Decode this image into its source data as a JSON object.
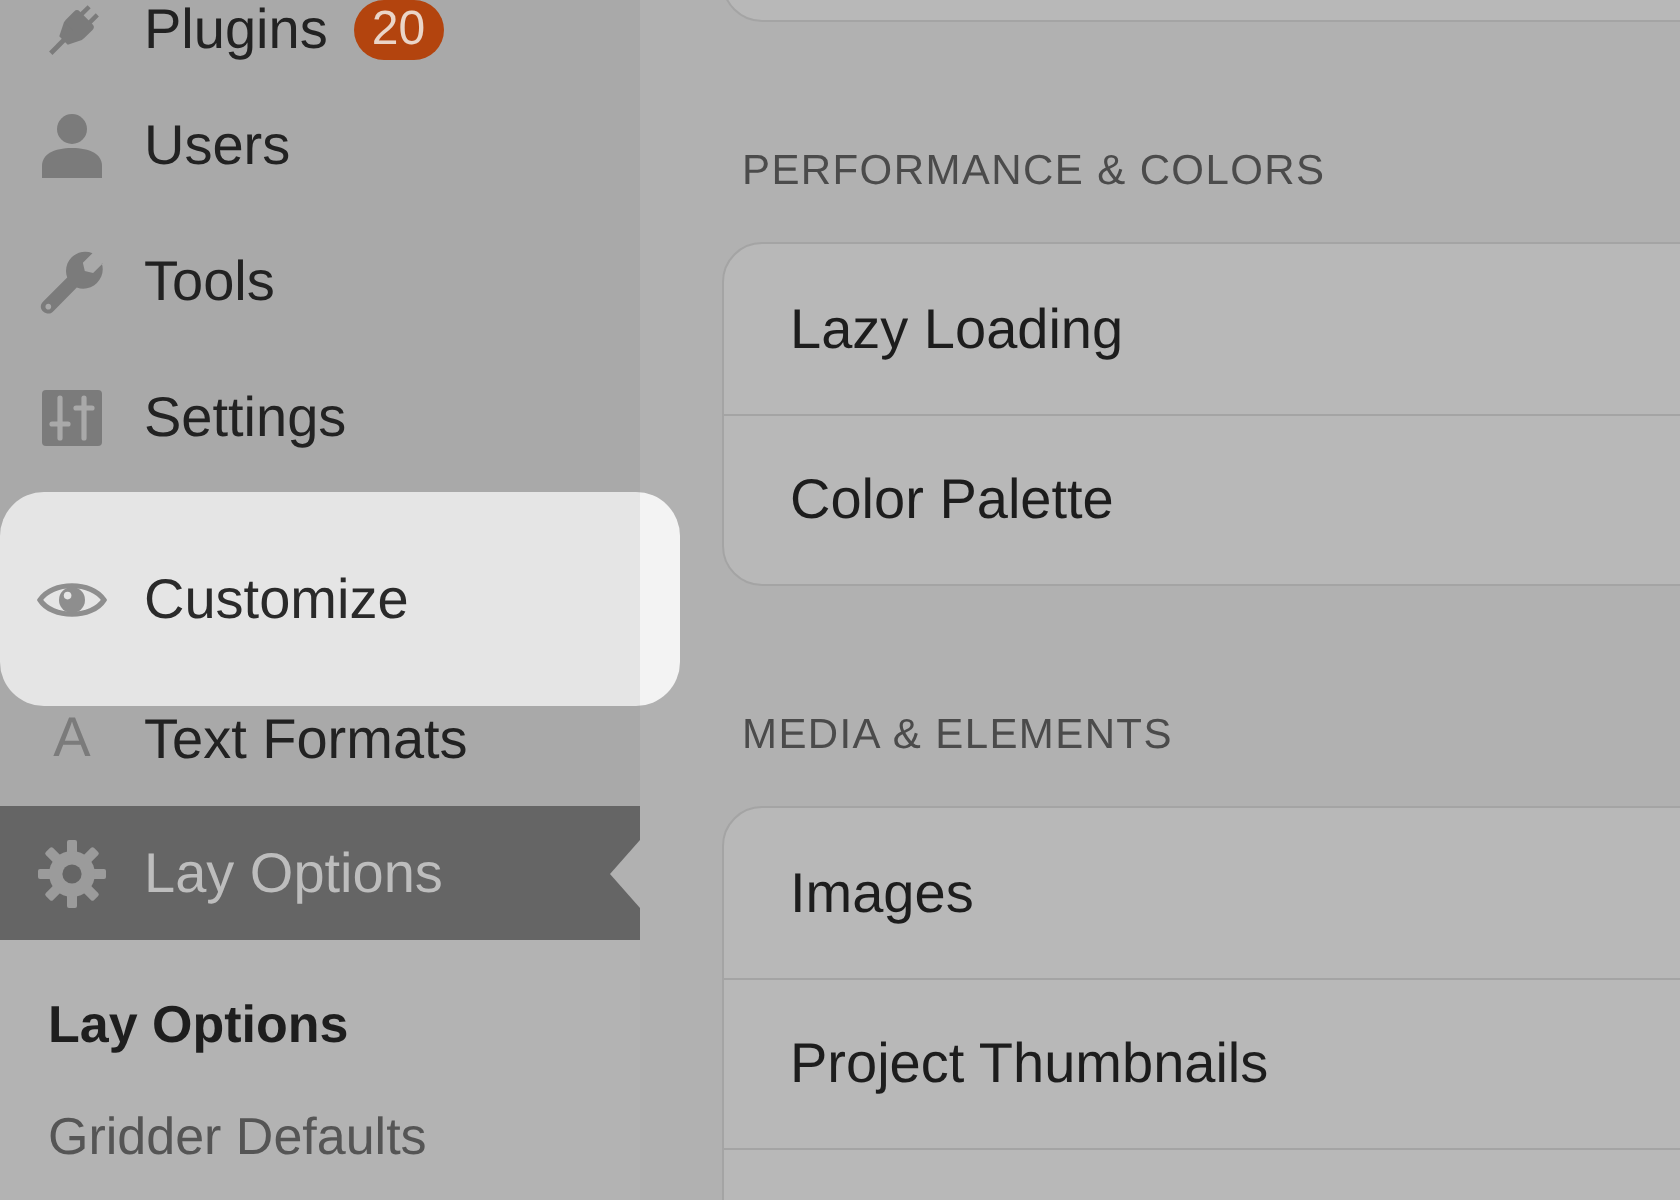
{
  "sidebar": {
    "menu": [
      {
        "label": "Plugins",
        "badge": "20",
        "highlighted": false,
        "current": false
      },
      {
        "label": "Users",
        "highlighted": false,
        "current": false
      },
      {
        "label": "Tools",
        "highlighted": false,
        "current": false
      },
      {
        "label": "Settings",
        "highlighted": false,
        "current": false
      },
      {
        "label": "Customize",
        "highlighted": true,
        "current": false
      },
      {
        "label": "Text Formats",
        "glyph": "A",
        "highlighted": false,
        "current": false
      },
      {
        "label": "Lay Options",
        "highlighted": false,
        "current": true,
        "children": [
          {
            "label": "Lay Options",
            "selected": true
          },
          {
            "label": "Gridder Defaults",
            "selected": false
          }
        ]
      }
    ]
  },
  "main": {
    "sections": [
      {
        "heading": "PERFORMANCE & COLORS",
        "rows": [
          {
            "label": "Lazy Loading"
          },
          {
            "label": "Color Palette"
          }
        ]
      },
      {
        "heading": "MEDIA & ELEMENTS",
        "rows": [
          {
            "label": "Images"
          },
          {
            "label": "Project Thumbnails"
          }
        ]
      }
    ]
  }
}
